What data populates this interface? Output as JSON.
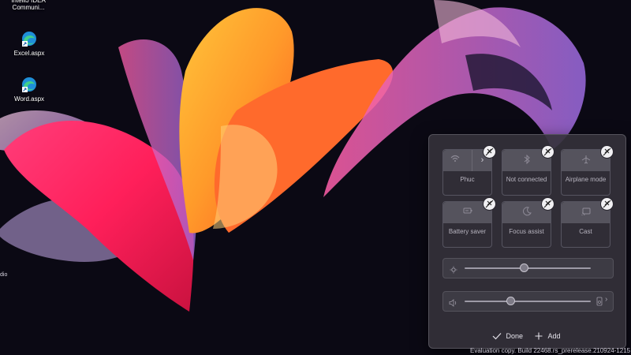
{
  "desktop": {
    "icons": [
      {
        "label": "IntelliJ IDEA Communi...",
        "icon": "intellij-app-icon"
      },
      {
        "label": "Excel.aspx",
        "icon": "edge-shortcut-icon"
      },
      {
        "label": "Word.aspx",
        "icon": "edge-shortcut-icon"
      }
    ],
    "edge_text": "dio"
  },
  "quick_settings": {
    "tiles": [
      {
        "label": "Phuc",
        "icon": "wifi-icon",
        "has_chevron": true
      },
      {
        "label": "Not connected",
        "icon": "bluetooth-icon"
      },
      {
        "label": "Airplane mode",
        "icon": "airplane-icon"
      },
      {
        "label": "Battery saver",
        "icon": "battery-saver-icon"
      },
      {
        "label": "Focus assist",
        "icon": "moon-icon"
      },
      {
        "label": "Cast",
        "icon": "cast-icon"
      }
    ],
    "brightness": {
      "icon": "sun-icon",
      "level": 0.47
    },
    "volume": {
      "icon": "speaker-icon",
      "level": 0.36,
      "output_icon": "speaker-device-icon"
    },
    "done_label": "Done",
    "add_label": "Add"
  },
  "watermark": "Evaluation copy. Build 22468.rs_prerelease.210924-1215"
}
